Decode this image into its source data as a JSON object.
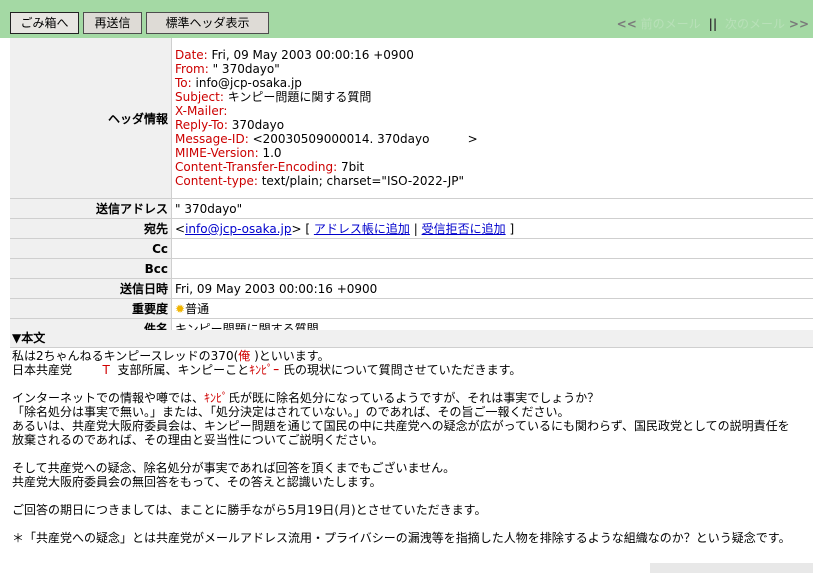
{
  "toolbar": {
    "trash_label": "ごみ箱へ",
    "resend_label": "再送信",
    "header_toggle_label": "標準ヘッダ表示",
    "prev_arrow": "<<",
    "prev_label": "前のメール",
    "separator": "||",
    "next_label": "次のメール",
    "next_arrow": ">>"
  },
  "headers": {
    "label": "ヘッダ情報",
    "lines": [
      {
        "key": "Date:",
        "value": " Fri, 09 May 2003 00:00:16 +0900"
      },
      {
        "key": "From:",
        "value": " \" 370dayo\""
      },
      {
        "key": "To:",
        "value": " info@jcp-osaka.jp"
      },
      {
        "key": "Subject:",
        "value": " キンピー問題に関する質問"
      },
      {
        "key": "X-Mailer:",
        "value": ""
      },
      {
        "key": "Reply-To:",
        "value": "  370dayo"
      },
      {
        "key": "Message-ID:",
        "value": " <20030509000014. 370dayo          >"
      },
      {
        "key": "MIME-Version:",
        "value": " 1.0"
      },
      {
        "key": "Content-Transfer-Encoding:",
        "value": " 7bit"
      },
      {
        "key": "Content-type:",
        "value": " text/plain; charset=\"ISO-2022-JP\""
      }
    ]
  },
  "fields": {
    "sender_label": "送信アドレス",
    "sender_value": "\" 370dayo\"",
    "to_label": "宛先",
    "to_open": "<",
    "to_email": "info@jcp-osaka.jp",
    "to_close": ">",
    "bracket_open": "[",
    "add_address_label": "アドレス帳に追加",
    "pipe": "|",
    "block_label": "受信拒否に追加",
    "bracket_close": "]",
    "cc_label": "Cc",
    "cc_value": "",
    "bcc_label": "Bcc",
    "bcc_value": "",
    "date_label": "送信日時",
    "date_value": "Fri, 09 May 2003 00:00:16 +0900",
    "priority_label": "重要度",
    "priority_value": "普通",
    "subject_label": "件名",
    "subject_value": "キンピー問題に関する質問"
  },
  "body": {
    "heading": "▼本文",
    "line1": "私は2ちゃんねるキンピースレッドの370(",
    "line1_red": "俺",
    "line1_end": " )といいます。",
    "line2a": "日本共産党",
    "line2_red1": "T",
    "line2b": "  支部所属、キンピーこと",
    "line2_red2": "ｷﾝﾋﾟｰ",
    "line2c": " 氏の現状について質問させていただきます。",
    "line3a": "インターネットでの情報や噂では、",
    "line3_red": "ｷﾝﾋﾟ",
    "line3b": "氏が既に除名処分になっているようですが、それは事実でしょうか？",
    "line4": "「除名処分は事実で無い。」または、「処分決定はされていない。」のであれば、その旨ご一報ください。",
    "line5": "あるいは、共産党大阪府委員会は、キンピー問題を通じて国民の中に共産党への疑念が広がっているにも関わらず、国民政党としての説明責任を",
    "line6": "放棄されるのであれば、その理由と妥当性についてご説明ください。",
    "line7": "そして共産党への疑念、除名処分が事実であれば回答を頂くまでもございません。",
    "line8": "共産党大阪府委員会の無回答をもって、その答えと認識いたします。",
    "line9": "ご回答の期日につきましては、まことに勝手ながら5月19日(月)とさせていただきます。",
    "line10": "＊「共産党への疑念」とは共産党がメールアドレス流用・プライバシーの漏洩等を指摘した人物を排除するような組織なのか？という疑念です。"
  },
  "icons": {
    "priority": "sun-icon"
  },
  "colors": {
    "toolbar_bg": "#a4d9a4",
    "header_key": "#cc0000",
    "link": "#0000cc",
    "label_bg": "#f0f0f0"
  }
}
